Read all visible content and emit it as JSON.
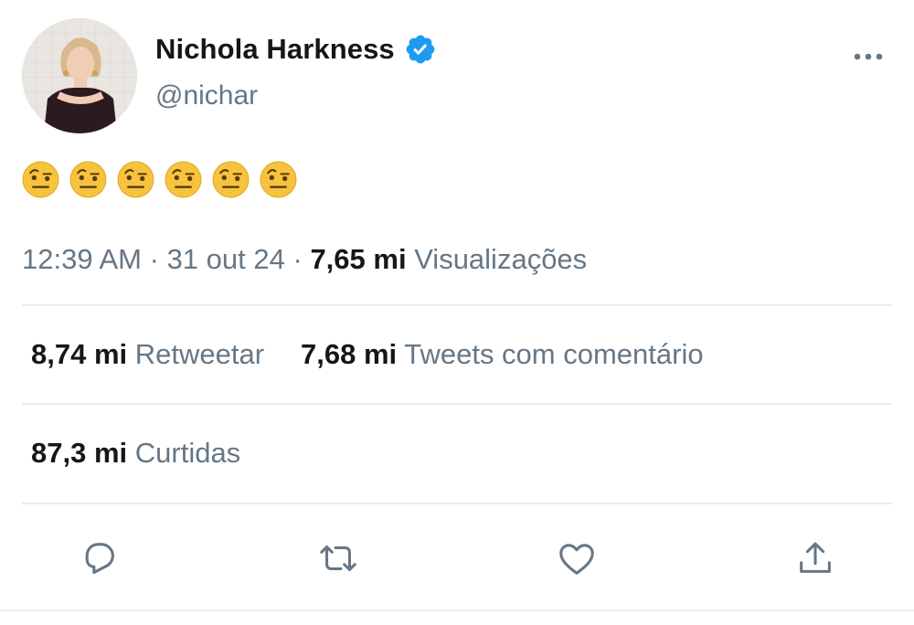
{
  "author": {
    "display_name": "Nichola Harkness",
    "handle": "@nichar",
    "verified": true
  },
  "tweet": {
    "emoji_icon": "face-with-raised-eyebrow",
    "emoji_count": 6
  },
  "meta": {
    "time": "12:39 AM",
    "separator": "·",
    "date": "31 out 24",
    "views_count": "7,65 mi",
    "views_label": "Visualizações"
  },
  "stats": {
    "retweets_count": "8,74 mi",
    "retweets_label": "Retweetar",
    "quotes_count": "7,68 mi",
    "quotes_label": "Tweets com comentário",
    "likes_count": "87,3 mi",
    "likes_label": "Curtidas"
  },
  "actions": {
    "reply_icon": "reply-icon",
    "retweet_icon": "retweet-icon",
    "like_icon": "heart-icon",
    "share_icon": "share-icon"
  },
  "colors": {
    "verified": "#1d9bf0",
    "secondary_text": "#657786",
    "divider": "#e6ecf0",
    "emoji_face": "#f7c33f"
  }
}
